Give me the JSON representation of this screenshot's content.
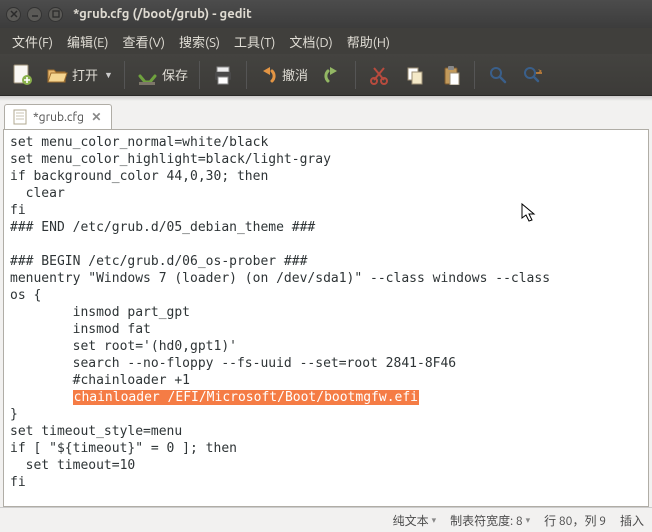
{
  "window": {
    "title": "*grub.cfg (/boot/grub) - gedit"
  },
  "menu": {
    "file": "文件(F)",
    "edit": "编辑(E)",
    "view": "查看(V)",
    "search": "搜索(S)",
    "tools": "工具(T)",
    "docs": "文档(D)",
    "help": "帮助(H)"
  },
  "toolbar": {
    "open": "打开",
    "save": "保存",
    "undo": "撤消"
  },
  "tab": {
    "label": "*grub.cfg"
  },
  "editor": {
    "lines": [
      "set menu_color_normal=white/black",
      "set menu_color_highlight=black/light-gray",
      "if background_color 44,0,30; then",
      "  clear",
      "fi",
      "### END /etc/grub.d/05_debian_theme ###",
      "",
      "### BEGIN /etc/grub.d/06_os-prober ###",
      "menuentry \"Windows 7 (loader) (on /dev/sda1)\" --class windows --class ",
      "os {",
      "        insmod part_gpt",
      "        insmod fat",
      "        set root='(hd0,gpt1)'",
      "        search --no-floppy --fs-uuid --set=root 2841-8F46",
      "        #chainloader +1",
      [
        "        ",
        "chainloader /EFI/Microsoft/Boot/bootmgfw.efi"
      ],
      "}",
      "set timeout_style=menu",
      "if [ \"${timeout}\" = 0 ]; then",
      "  set timeout=10",
      "fi"
    ]
  },
  "status": {
    "syntax": "纯文本",
    "tabwidth_label": "制表符宽度:",
    "tabwidth": "8",
    "line_label": "行",
    "line": "80",
    "col_sep": "，列",
    "col": "9",
    "insert": "插入"
  }
}
